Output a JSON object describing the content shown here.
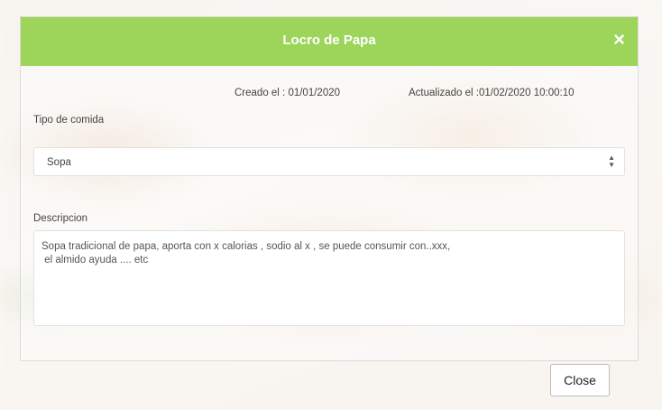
{
  "modal": {
    "title": "Locro de Papa",
    "close_icon": "×",
    "created": "Creado el : 01/01/2020",
    "updated": "Actualizado el :01/02/2020 10:00:10",
    "type_label": "Tipo de comida",
    "type_value": "Sopa",
    "description_label": "Descripcion",
    "description_lines": [
      "Sopa tradicional de papa, aporta con x calorias , sodio al x , se puede consumir con..xxx,",
      " el almido ayuda .... etc"
    ],
    "close_button_label": "Close"
  },
  "colors": {
    "header": "#9dd45a"
  },
  "icons": {
    "header_close": "close-icon",
    "select_arrows": "sort-arrows-icon"
  }
}
